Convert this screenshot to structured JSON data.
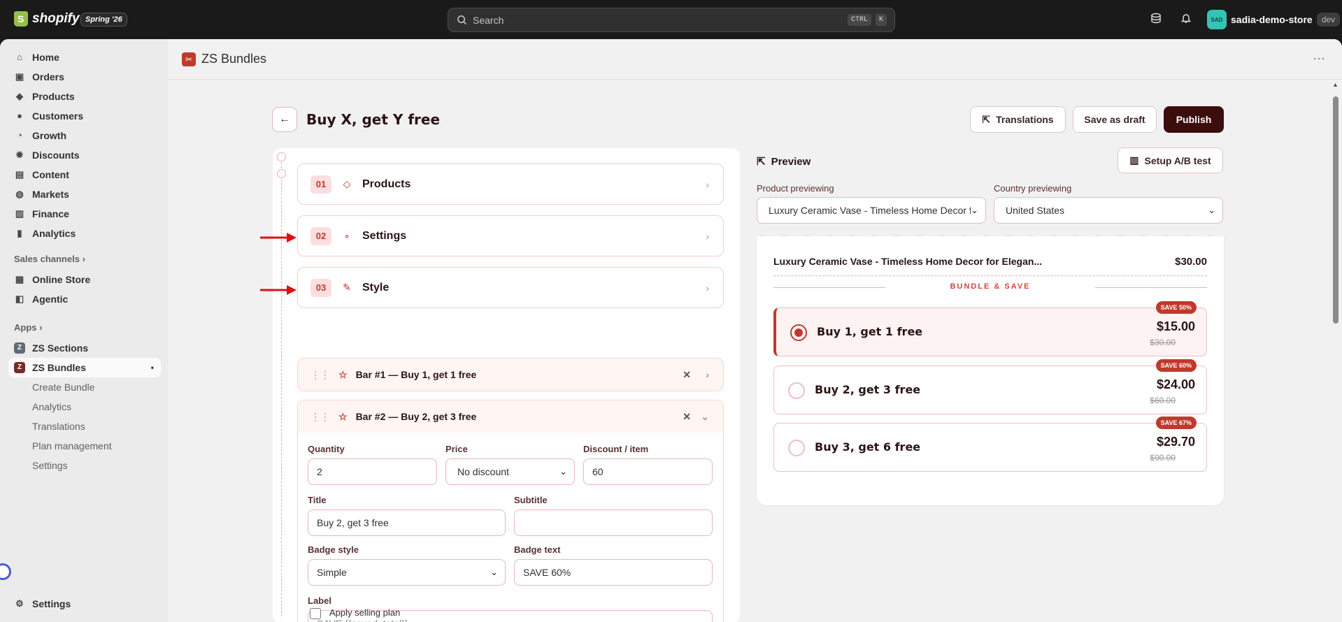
{
  "topbar": {
    "brand": "shopify",
    "edition": "Spring '26",
    "search_placeholder": "Search",
    "shortcut_ctrl": "CTRL",
    "shortcut_key": "K",
    "store_initials": "SAD",
    "store_name": "sadia-demo-store",
    "store_tag": "dev"
  },
  "sidebar": {
    "items": [
      {
        "label": "Home",
        "icon": "home-icon"
      },
      {
        "label": "Orders",
        "icon": "inbox-icon"
      },
      {
        "label": "Products",
        "icon": "tag-icon"
      },
      {
        "label": "Customers",
        "icon": "person-icon"
      },
      {
        "label": "Growth",
        "icon": "growth-icon"
      },
      {
        "label": "Discounts",
        "icon": "discount-icon"
      },
      {
        "label": "Content",
        "icon": "content-icon"
      },
      {
        "label": "Markets",
        "icon": "globe-icon"
      },
      {
        "label": "Finance",
        "icon": "bank-icon"
      },
      {
        "label": "Analytics",
        "icon": "chart-icon"
      }
    ],
    "sales_channels_heading": "Sales channels",
    "channels": [
      {
        "label": "Online Store"
      },
      {
        "label": "Agentic"
      }
    ],
    "apps_heading": "Apps",
    "apps": [
      {
        "label": "ZS Sections"
      },
      {
        "label": "ZS Bundles"
      }
    ],
    "app_subitems": [
      "Create Bundle",
      "Analytics",
      "Translations",
      "Plan management",
      "Settings"
    ],
    "settings_label": "Settings"
  },
  "appbar": {
    "title": "ZS Bundles"
  },
  "page": {
    "title": "Buy X, get Y free",
    "translations_label": "Translations",
    "save_draft_label": "Save as draft",
    "publish_label": "Publish"
  },
  "steps": [
    {
      "num": "01",
      "label": "Products"
    },
    {
      "num": "02",
      "label": "Settings"
    },
    {
      "num": "03",
      "label": "Style"
    }
  ],
  "bars": {
    "bar1_title": "Bar #1 — Buy 1, get 1 free",
    "bar2_title": "Bar #2 — Buy 2, get 3 free",
    "form": {
      "quantity_label": "Quantity",
      "quantity_value": "2",
      "price_label": "Price",
      "price_value": "No discount",
      "discount_label": "Discount / item",
      "discount_value": "60",
      "title_label": "Title",
      "title_value": "Buy 2, get 3 free",
      "subtitle_label": "Subtitle",
      "subtitle_value": "",
      "badge_style_label": "Badge style",
      "badge_style_value": "Simple",
      "badge_text_label": "Badge text",
      "badge_text_value": "SAVE 60%",
      "label_label": "Label",
      "label_placeholder": "SAVE {{saved_total}}",
      "selling_plan_label": "Apply selling plan"
    }
  },
  "preview": {
    "title": "Preview",
    "ab_test_label": "Setup A/B test",
    "product_label": "Product previewing",
    "product_value": "Luxury Ceramic Vase - Timeless Home Decor fo",
    "country_label": "Country previewing",
    "country_value": "United States",
    "product_name": "Luxury Ceramic Vase - Timeless Home Decor for Elegan...",
    "product_price": "$30.00",
    "bundle_heading": "BUNDLE & SAVE",
    "options": [
      {
        "title": "Buy 1, get 1 free",
        "price": "$15.00",
        "old_price": "$30.00",
        "badge": "SAVE 50%",
        "selected": true
      },
      {
        "title": "Buy 2, get 3 free",
        "price": "$24.00",
        "old_price": "$60.00",
        "badge": "SAVE 60%",
        "selected": false
      },
      {
        "title": "Buy 3, get 6 free",
        "price": "$29.70",
        "old_price": "$90.00",
        "badge": "SAVE 67%",
        "selected": false
      }
    ]
  },
  "colors": {
    "accent": "#c0392b",
    "publish_bg": "#3c0d0d",
    "topbar_bg": "#1a1a1a"
  }
}
